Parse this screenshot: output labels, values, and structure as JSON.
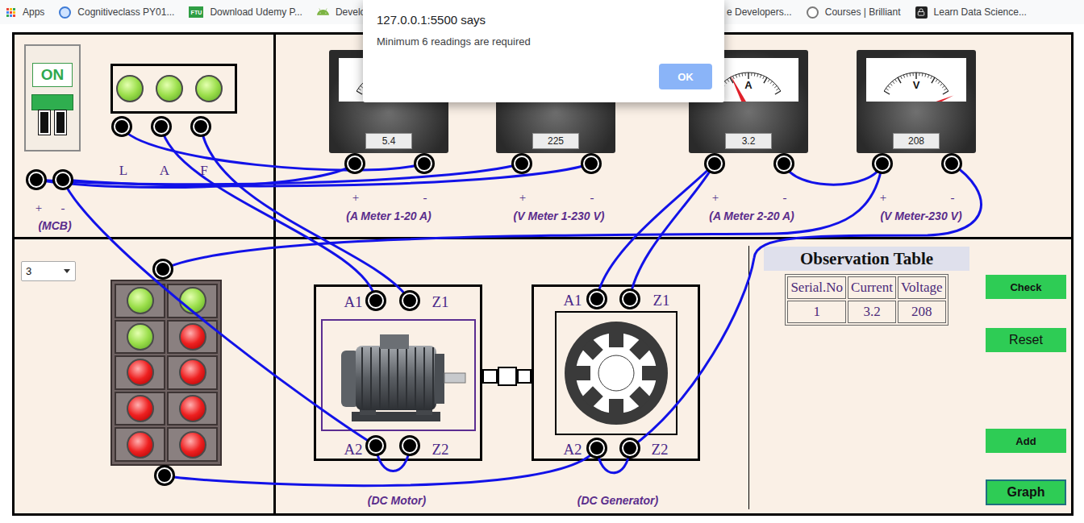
{
  "bookmarks": {
    "left": [
      {
        "label": "Apps",
        "badge": null
      },
      {
        "label": "Cognitiveclass PY01...",
        "badge": null
      },
      {
        "label": "Download Udemy P...",
        "badge": "FTU"
      },
      {
        "label": "Develop",
        "badge": null
      }
    ],
    "right": [
      {
        "label": "e Developers...",
        "badge": null
      },
      {
        "label": "Courses | Brilliant",
        "badge": null
      },
      {
        "label": "Learn Data Science...",
        "badge": null
      }
    ]
  },
  "dialog": {
    "origin": "127.0.0.1:5500 says",
    "message": "Minimum 6 readings are required",
    "button": "OK"
  },
  "mcb": {
    "switch_label": "ON",
    "on": true,
    "terminals": [
      "+",
      "-"
    ],
    "caption": "(MCB)"
  },
  "supply_lamps": {
    "lamps": [
      {
        "lit": true
      },
      {
        "lit": true
      },
      {
        "lit": true
      }
    ],
    "terminals": [
      "L",
      "A",
      "F"
    ]
  },
  "meters": [
    {
      "unit": null,
      "reading": "5.4",
      "level": 0.95,
      "terminals": [
        "+",
        "-"
      ],
      "caption": "(A Meter 1-20 A)"
    },
    {
      "unit": null,
      "reading": "225",
      "level": 0.97,
      "terminals": [
        "+",
        "-"
      ],
      "caption": "(V Meter 1-230 V)"
    },
    {
      "unit": "A",
      "reading": "3.2",
      "level": 0.31,
      "terminals": [
        "+",
        "-"
      ],
      "caption": "(A Meter 2-20 A)"
    },
    {
      "unit": "V",
      "reading": "208",
      "level": 0.98,
      "terminals": [
        "+",
        "-"
      ],
      "caption": "(V Meter-230 V)"
    }
  ],
  "load": {
    "selector": {
      "value": "3"
    },
    "lamps": [
      {
        "lit": true
      },
      {
        "lit": true
      },
      {
        "lit": true
      },
      {
        "lit": false
      },
      {
        "lit": false
      },
      {
        "lit": false
      },
      {
        "lit": false
      },
      {
        "lit": false
      },
      {
        "lit": false
      },
      {
        "lit": false
      }
    ]
  },
  "motor": {
    "terminals": [
      "A1",
      "Z1",
      "A2",
      "Z2"
    ],
    "caption": "(DC Motor)"
  },
  "generator": {
    "terminals": [
      "A1",
      "Z1",
      "A2",
      "Z2"
    ],
    "caption": "(DC Generator)"
  },
  "observation_table": {
    "title": "Observation Table",
    "columns": [
      "Serial.No",
      "Current",
      "Voltage"
    ],
    "rows": [
      [
        "1",
        "3.2",
        "208"
      ]
    ]
  },
  "buttons": [
    {
      "label": "Check",
      "focused": false
    },
    {
      "label": "Reset",
      "focused": false
    },
    {
      "label": "Add",
      "focused": false
    },
    {
      "label": "Graph",
      "focused": true
    }
  ]
}
